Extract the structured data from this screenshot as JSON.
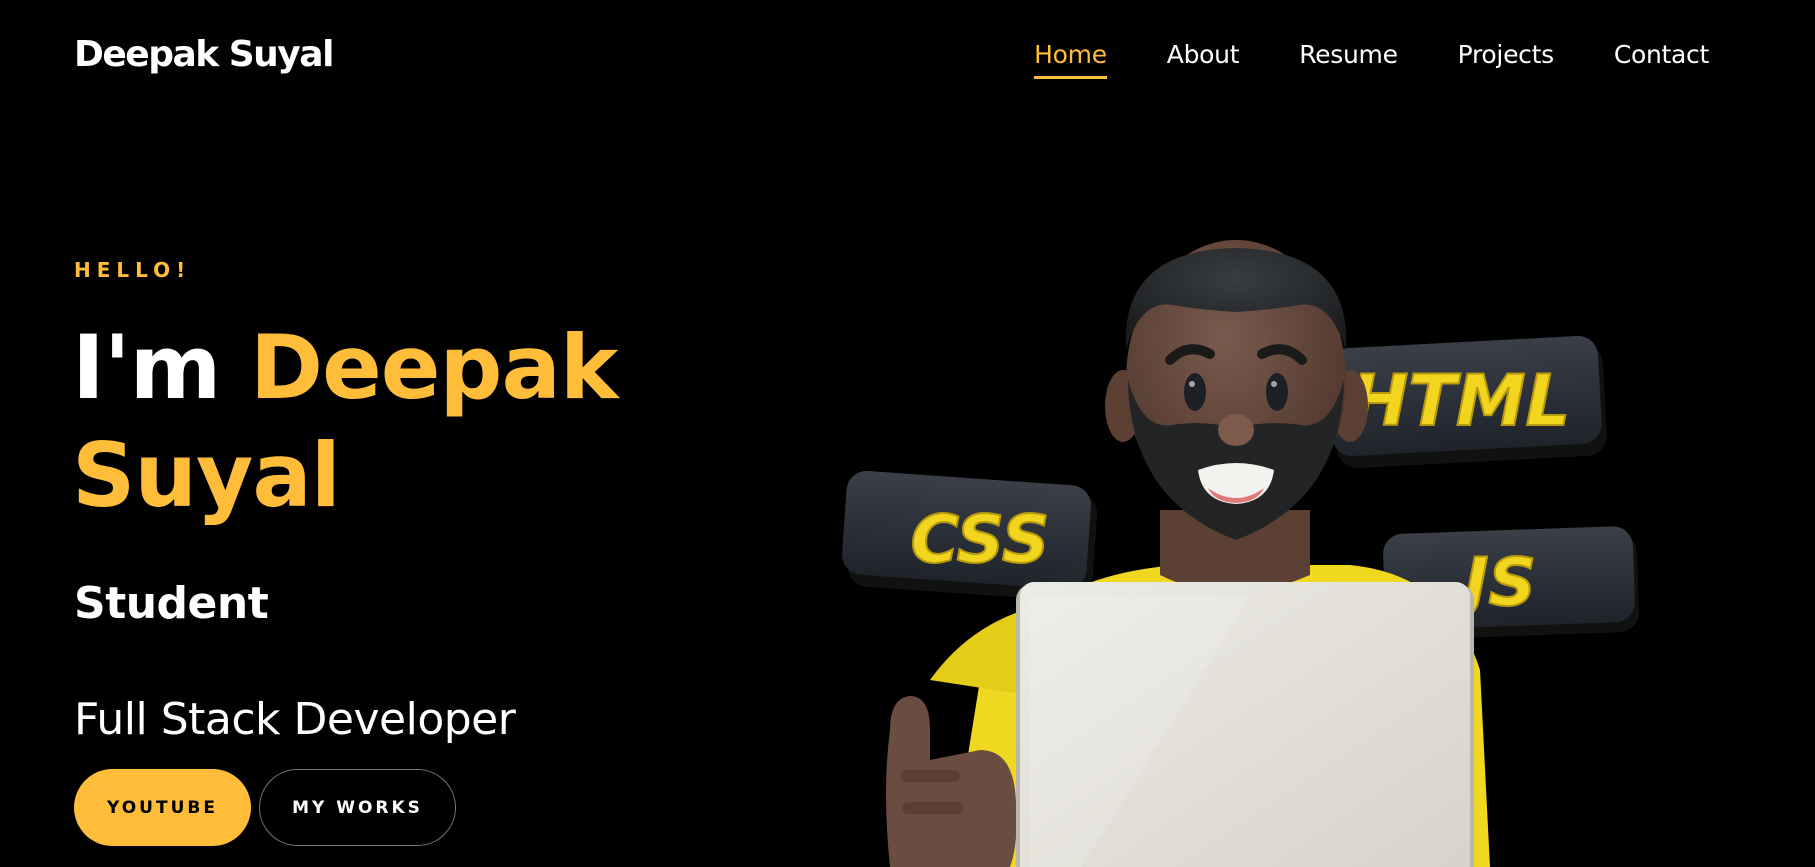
{
  "brand": "Deepak Suyal",
  "nav": {
    "items": [
      "Home",
      "About",
      "Resume",
      "Projects",
      "Contact"
    ],
    "active": "Home"
  },
  "hero": {
    "greeting": "HELLO!",
    "intro": "I'm",
    "first_name": "Deepak",
    "last_name": "Suyal",
    "role": "Student",
    "typed_text": "Full Stack Developer",
    "buttons": {
      "youtube": "YOUTUBE",
      "works": "MY WORKS"
    }
  },
  "illustration": {
    "badges": [
      "HTML",
      "CSS",
      "JS"
    ]
  },
  "colors": {
    "accent": "#ffbd39",
    "background": "#000000",
    "text": "#ffffff"
  }
}
